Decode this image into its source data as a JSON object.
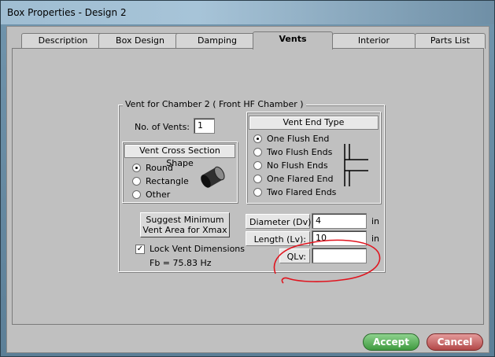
{
  "window": {
    "title": "Box Properties - Design 2"
  },
  "tabs": [
    {
      "label": "Description"
    },
    {
      "label": "Box Design"
    },
    {
      "label": "Damping"
    },
    {
      "label": "Vents"
    },
    {
      "label": "Interior"
    },
    {
      "label": "Parts List"
    }
  ],
  "active_tab": "Vents",
  "vent_group": {
    "title": "Vent for Chamber 2  ( Front HF Chamber )",
    "num_vents_label": "No. of Vents:",
    "num_vents_value": "1",
    "shape": {
      "title": "Vent Cross Section Shape",
      "options": [
        "Round",
        "Rectangle",
        "Other"
      ],
      "selected": "Round"
    },
    "end_type": {
      "title": "Vent End Type",
      "options": [
        "One Flush End",
        "Two Flush Ends",
        "No Flush Ends",
        "One Flared End",
        "Two Flared Ends"
      ],
      "selected": "One Flush End"
    },
    "suggest_button": {
      "line1": "Suggest Minimum",
      "line2": "Vent Area for Xmax"
    },
    "lock_label": "Lock Vent Dimensions",
    "lock_checked": true,
    "fb_text": "Fb = 75.83 Hz",
    "diameter": {
      "label": "Diameter (Dv):",
      "value": "4",
      "unit": "in"
    },
    "length": {
      "label": "Length (Lv):",
      "value": "10",
      "unit": "in"
    },
    "qlv": {
      "label": "QLv:",
      "value": ""
    }
  },
  "buttons": {
    "accept": "Accept",
    "cancel": "Cancel"
  },
  "colors": {
    "accept": "#3f9a3f",
    "cancel": "#b24848",
    "annotation": "#e0141e"
  }
}
